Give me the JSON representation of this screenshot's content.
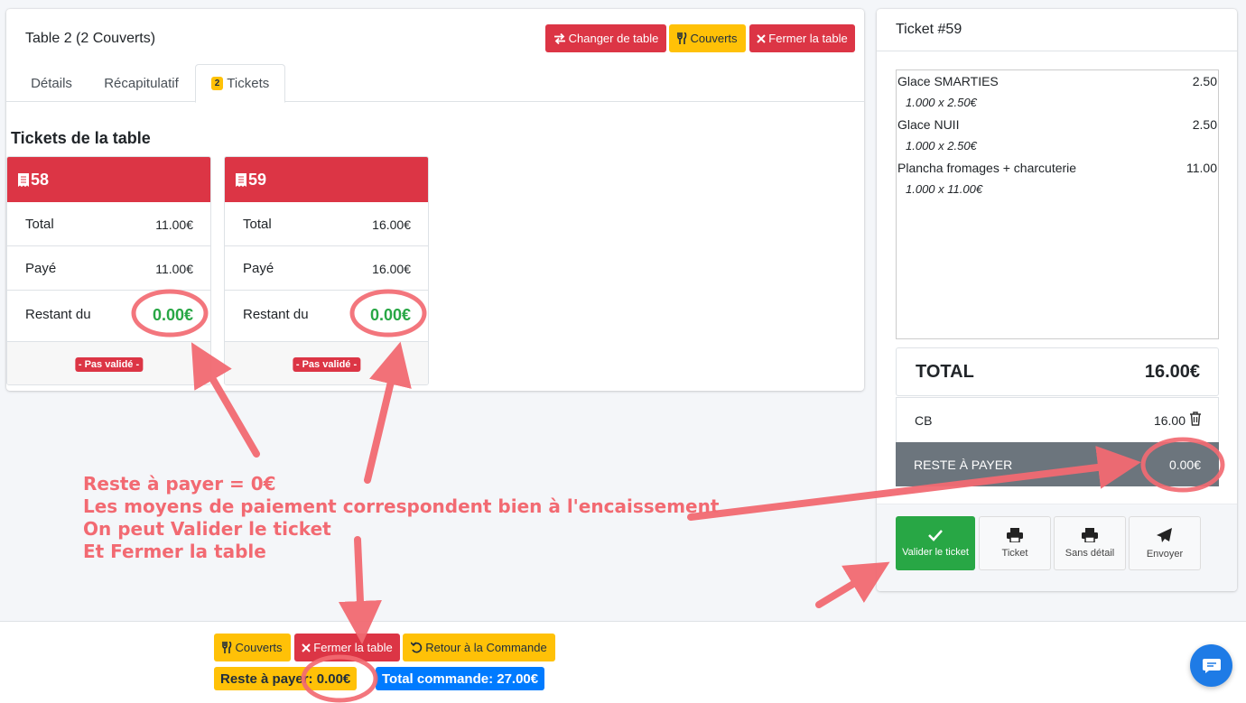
{
  "table": {
    "title": "Table 2 (2 Couverts)",
    "buttons": {
      "change_table": "Changer de table",
      "couverts": "Couverts",
      "close_table": "Fermer la table"
    },
    "tabs": [
      {
        "label": "Détails"
      },
      {
        "label": "Récapitulatif"
      },
      {
        "label": "Tickets",
        "badge": "2"
      }
    ],
    "section_title": "Tickets de la table",
    "tickets": [
      {
        "number": "58",
        "total_label": "Total",
        "total": "11.00€",
        "paid_label": "Payé",
        "paid": "11.00€",
        "remaining_label": "Restant du",
        "remaining": "0.00€",
        "status": "- Pas validé -"
      },
      {
        "number": "59",
        "total_label": "Total",
        "total": "16.00€",
        "paid_label": "Payé",
        "paid": "16.00€",
        "remaining_label": "Restant du",
        "remaining": "0.00€",
        "status": "- Pas validé -"
      }
    ]
  },
  "ticket": {
    "title": "Ticket #59",
    "items": [
      {
        "name": "Glace SMARTIES",
        "price": "2.50",
        "detail": "1.000 x 2.50€"
      },
      {
        "name": "Glace NUII",
        "price": "2.50",
        "detail": "1.000 x 2.50€"
      },
      {
        "name": "Plancha fromages + charcuterie",
        "price": "11.00",
        "detail": "1.000 x 11.00€"
      }
    ],
    "total_label": "TOTAL",
    "total": "16.00€",
    "payment_method": "CB",
    "payment_amount": "16.00",
    "remaining_label": "RESTE À PAYER",
    "remaining": "0.00€",
    "actions": {
      "validate": "Valider le ticket",
      "ticket": "Ticket",
      "no_detail": "Sans détail",
      "send": "Envoyer"
    }
  },
  "bottom": {
    "couverts": "Couverts",
    "close_table": "Fermer la table",
    "back_to_order": "Retour à la Commande",
    "remaining": "Reste à payer: 0.00€",
    "total_order": "Total commande: 27.00€"
  },
  "annotation": {
    "lines": [
      "Reste à payer = 0€",
      "Les moyens de paiement correspondent bien à l'encaissement",
      "On peut Valider le ticket",
      "Et Fermer la table"
    ],
    "color": "#f26a72"
  },
  "colors": {
    "danger": "#dc3545",
    "warning": "#ffc107",
    "success": "#28a745",
    "primary": "#007bff",
    "secondary": "#6c757d"
  }
}
